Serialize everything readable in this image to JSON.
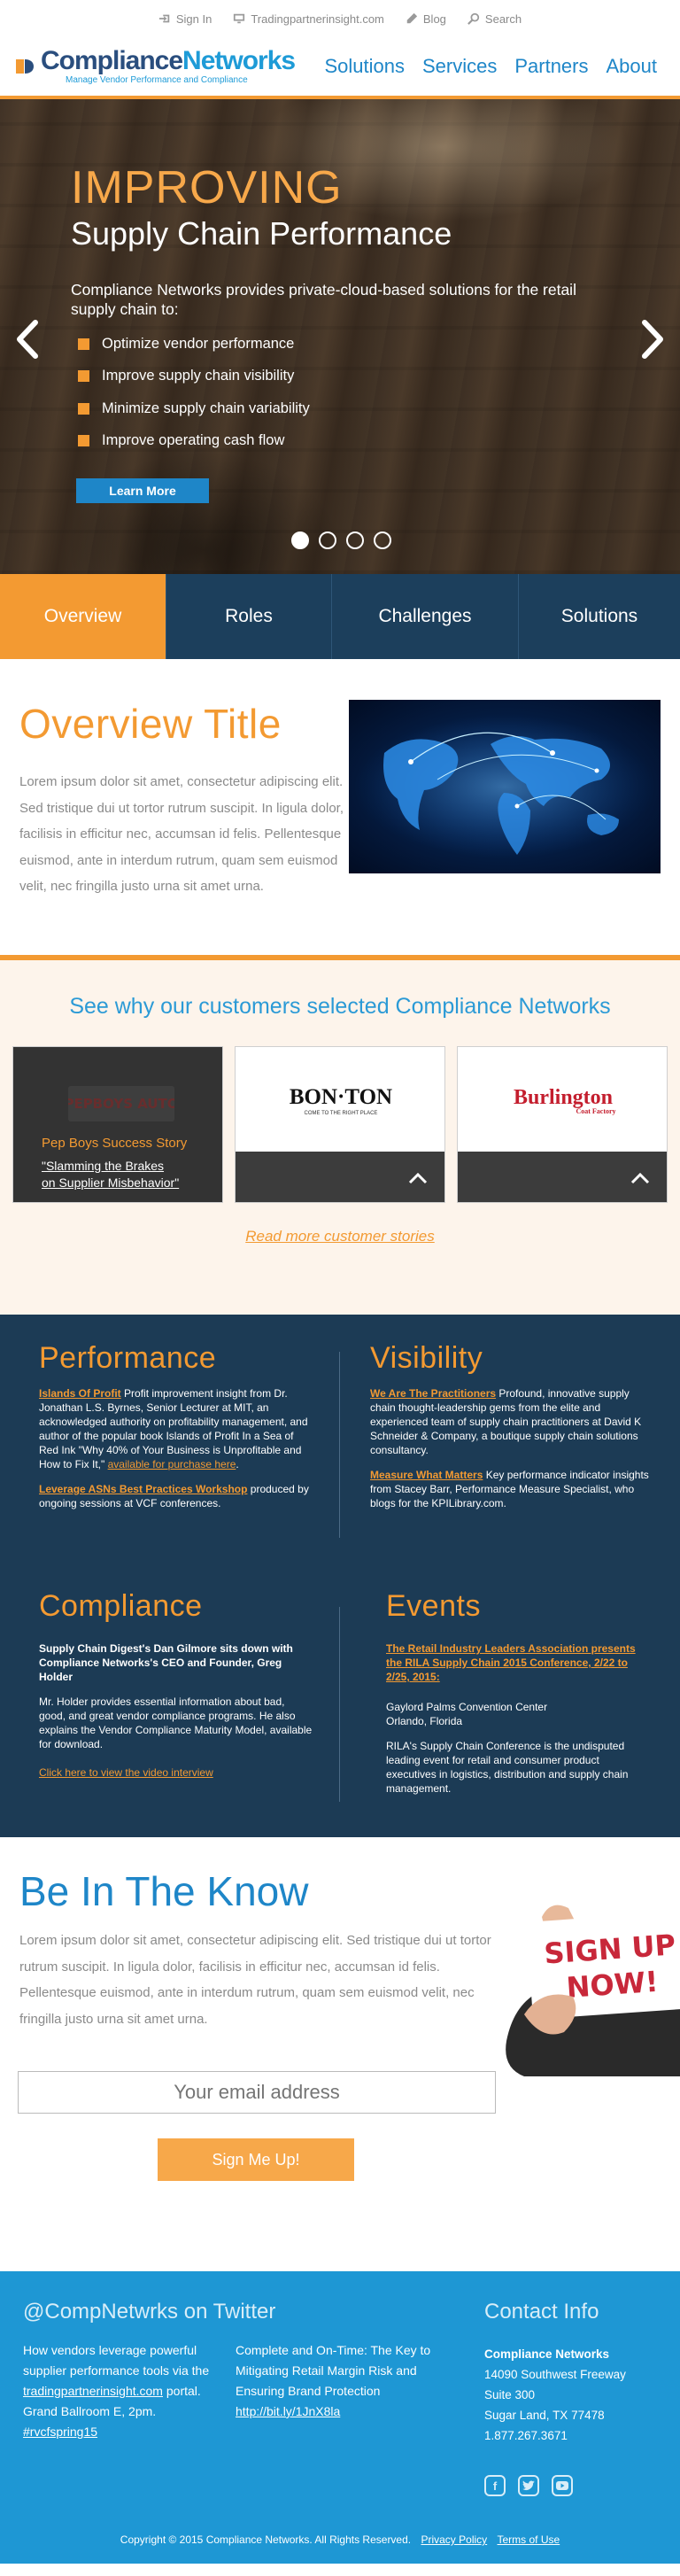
{
  "colors": {
    "orange": "#f39a32",
    "blue": "#1e86c8",
    "navy": "#1c3f5c",
    "footer_blue": "#1e97d4"
  },
  "utility": {
    "sign_in": "Sign In",
    "site": "Tradingpartnerinsight.com",
    "blog": "Blog",
    "search": "Search"
  },
  "logo": {
    "part1": "Compliance",
    "part2": "Networks",
    "tagline": "Manage Vendor Performance and Compliance"
  },
  "nav": {
    "items": [
      "Solutions",
      "Services",
      "Partners",
      "About"
    ]
  },
  "hero": {
    "title": "IMPROVING",
    "subtitle": "Supply Chain Performance",
    "description": "Compliance Networks provides private-cloud-based solutions for the retail supply chain to:",
    "bullets": [
      "Optimize vendor performance",
      "Improve supply chain visibility",
      "Minimize supply chain variability",
      "Improve operating cash flow"
    ],
    "button": "Learn More",
    "active_slide": 1,
    "slide_count": 4
  },
  "tabs": {
    "items": [
      "Overview",
      "Roles",
      "Challenges",
      "Solutions"
    ],
    "active": 0
  },
  "overview": {
    "title": "Overview Title",
    "body": "Lorem ipsum dolor sit amet, consectetur adipiscing elit. Sed tristique dui ut tortor rutrum suscipit. In ligula dolor, facilisis in efficitur nec, accumsan id felis. Pellentesque euismod, ante in interdum rutrum, quam sem euismod velit, nec fringilla justo urna sit amet urna."
  },
  "customers": {
    "title": "See why our customers selected Compliance Networks",
    "pepboys_logo": "PEPBOYS AUTO",
    "pepboys_caption": "Pep Boys Success Story",
    "pepboys_link_line1": "\"Slamming the Brakes",
    "pepboys_link_line2": "on Supplier Misbehavior\"",
    "bonton_logo": "BON·TON",
    "bonton_tag": "COME TO THE RIGHT PLACE",
    "burlington_logo": "Burlington",
    "burlington_tag": "Coat Factory",
    "read_more": "Read more customer stories"
  },
  "info": {
    "performance": {
      "title": "Performance",
      "p1_link": "Islands Of Profit",
      "p1_text": " Profit improvement insight from Dr. Jonathan L.S. Byrnes, Senior Lecturer at MIT, an acknowledged authority on profitability management, and author of the popular book Islands of Profit In a Sea of Red Ink \"Why 40% of Your Business is Unprofitable and How to Fix It,\" ",
      "p1_link2": "available for purchase here",
      "p2_link": "Leverage ASNs Best Practices Workshop",
      "p2_text": " produced by ongoing sessions at VCF conferences."
    },
    "visibility": {
      "title": "Visibility",
      "p1_link": "We Are The Practitioners",
      "p1_text": " Profound, innovative supply chain thought-leadership gems from the elite and experienced team of supply chain practitioners at David K Schneider & Company, a boutique supply chain solutions consultancy.",
      "p2_link": "Measure What Matters",
      "p2_text": " Key performance indicator insights from Stacey Barr, Performance Measure Specialist, who blogs for the KPILibrary.com."
    },
    "compliance": {
      "title": "Compliance",
      "headline": "Supply Chain Digest's Dan Gilmore sits down with Compliance Networks's CEO and Founder, Greg Holder",
      "body": "Mr. Holder provides essential information about bad, good, and great vendor compliance programs. He also explains the Vendor Compliance Maturity Model, available for download.",
      "link": "Click here to view the video interview"
    },
    "events": {
      "title": "Events",
      "link": "The Retail Industry Leaders Association presents the RILA Supply Chain 2015 Conference, 2/22 to 2/25, 2015:",
      "venue": "Gaylord Palms Convention Center",
      "city": "Orlando, Florida",
      "body": "RILA's Supply Chain Conference is the undisputed leading event for retail and consumer product executives in logistics, distribution and supply chain management."
    }
  },
  "know": {
    "title": "Be In The Know",
    "body": "Lorem ipsum dolor sit amet, consectetur adipiscing elit. Sed tristique dui ut tortor rutrum suscipit. In ligula dolor, facilisis in efficitur nec, accumsan id felis. Pellentesque euismod, ante in interdum rutrum, quam sem euismod velit, nec fringilla justo urna sit amet urna.",
    "email_placeholder": "Your email address",
    "button": "Sign Me Up!",
    "card_line1": "SIGN UP",
    "card_line2": "NOW!"
  },
  "footer": {
    "twitter_title": "@CompNetwrks on Twitter",
    "tweet1_pre": "How vendors leverage powerful supplier performance tools via the ",
    "tweet1_link": "tradingpartnerinsight.com",
    "tweet1_post": " portal. Grand Ballroom E, 2pm. ",
    "tweet1_tag": "#rvcfspring15",
    "tweet2_text": "Complete and On-Time: The Key to Mitigating Retail Margin Risk and Ensuring Brand Protection ",
    "tweet2_link": "http://bit.ly/1JnX8la",
    "contact_title": "Contact Info",
    "company": "Compliance Networks",
    "address1": "14090 Southwest Freeway",
    "address2": "Suite 300",
    "address3": "Sugar Land, TX  77478",
    "phone": "1.877.267.3671",
    "copyright": "Copyright © 2015 Compliance Networks. All Rights Reserved.",
    "privacy": "Privacy Policy",
    "terms": "Terms of Use"
  }
}
